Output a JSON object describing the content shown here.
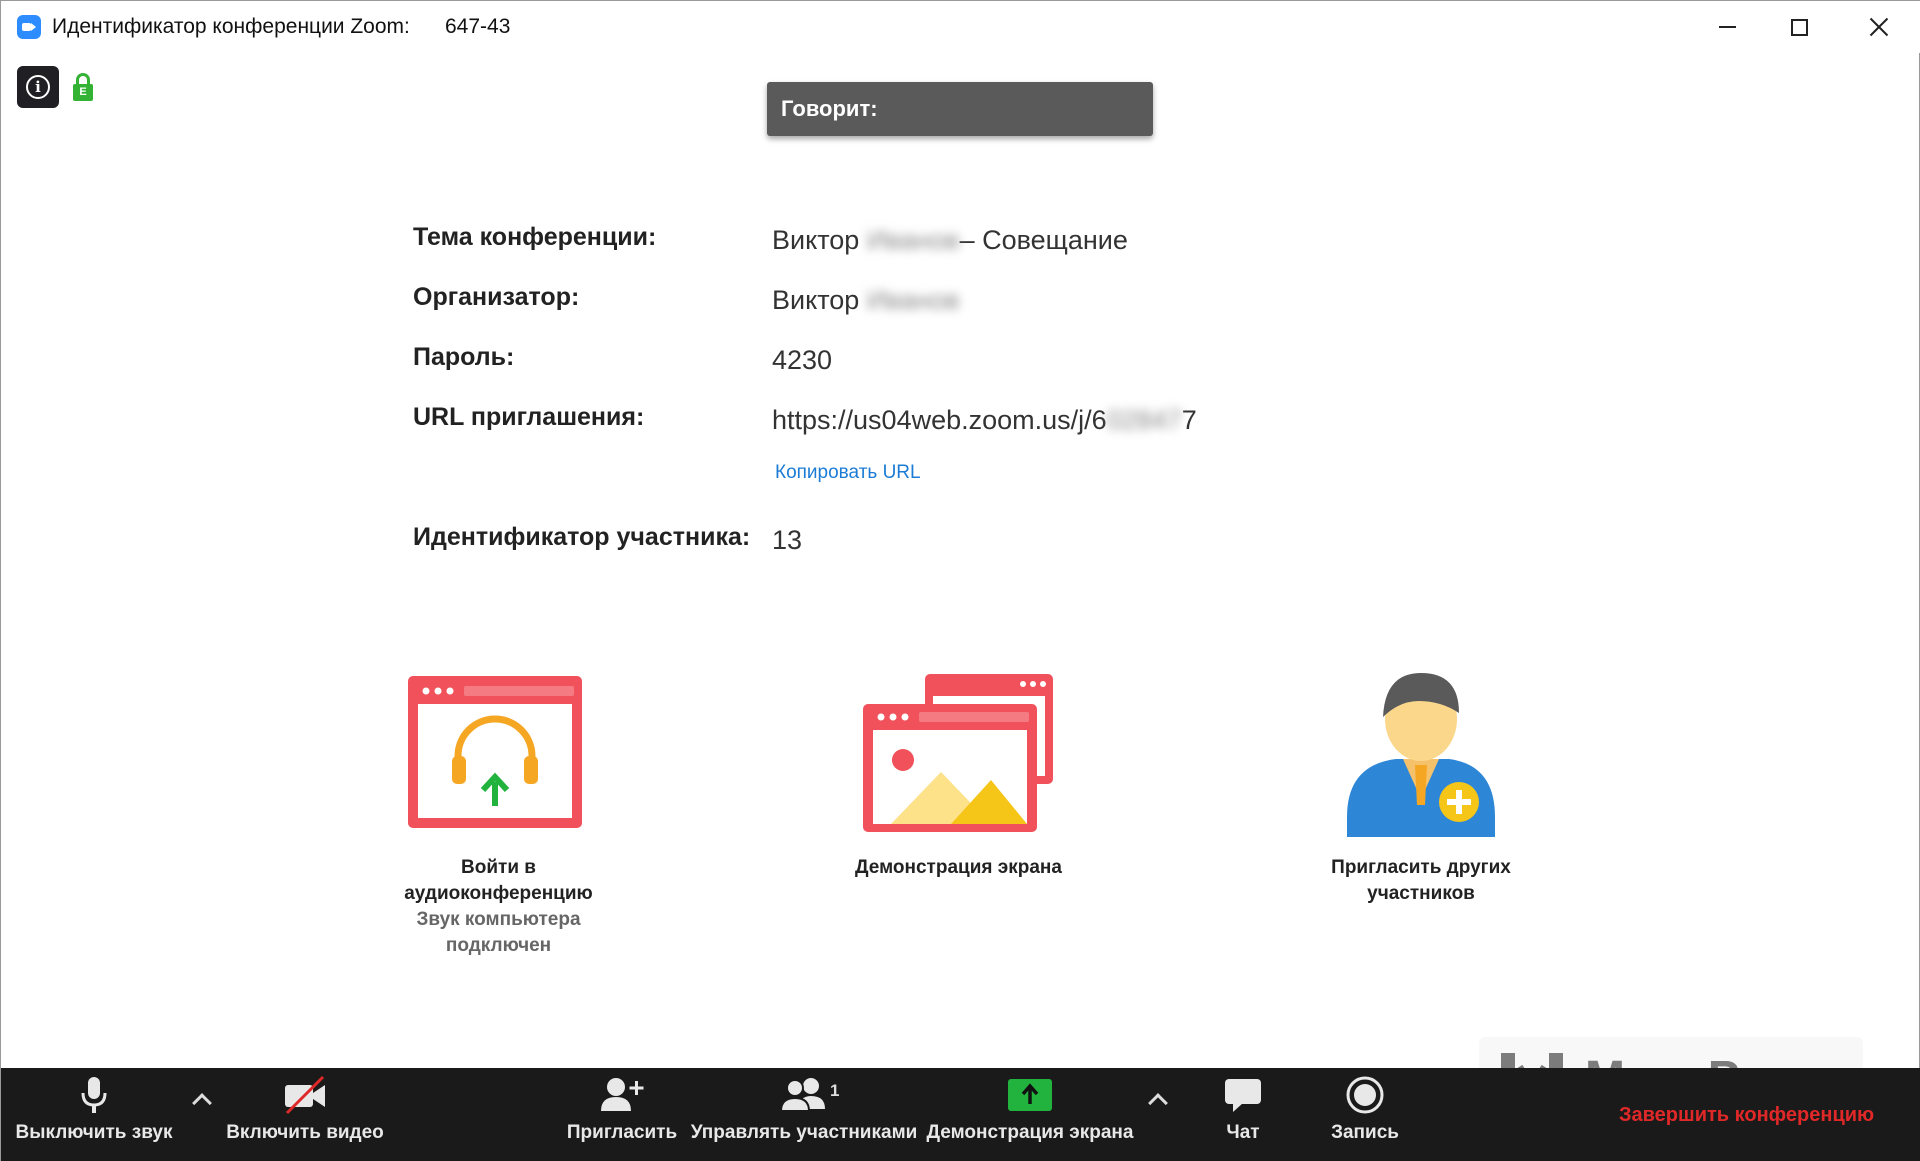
{
  "window": {
    "title": "Идентификатор конференции Zoom:",
    "meeting_id": "647-43"
  },
  "security": {
    "lock_letter": "E"
  },
  "speaking": {
    "label": "Говорит:"
  },
  "meeting_info": {
    "topic_label": "Тема конференции:",
    "topic_first": "Виктор",
    "topic_blurred": "Иванов",
    "topic_rest": "– Совещание",
    "host_label": "Организатор:",
    "host_first": "Виктор",
    "host_blurred": "Иванов",
    "password_label": "Пароль:",
    "password_value": "4230",
    "url_label": "URL приглашения:",
    "url_prefix": "https://us04web.zoom.us/j/6",
    "url_blurred": "02847",
    "url_suffix": "7",
    "copy_url": "Копировать URL",
    "participant_label": "Идентификатор участника:",
    "participant_value": "13"
  },
  "tiles": {
    "audio_line1": "Войти в",
    "audio_line2": "аудиоконференцию",
    "audio_status1": "Звук компьютера",
    "audio_status2": "подключен",
    "share": "Демонстрация экрана",
    "invite_line1": "Пригласить других",
    "invite_line2": "участников"
  },
  "toolbar": {
    "mute": "Выключить звук",
    "video": "Включить видео",
    "invite": "Пригласить",
    "participants": "Управлять участниками",
    "participants_count": "1",
    "share": "Демонстрация экрана",
    "chat": "Чат",
    "record": "Запись",
    "end": "Завершить конференцию"
  },
  "watermark": {
    "text": "MegaProgz"
  },
  "colors": {
    "accent_blue": "#2d8cff",
    "lock_green": "#34b233",
    "link_blue": "#1c7cd5",
    "tile_red": "#f0515b",
    "end_red": "#e02828",
    "toolbar_bg": "#1a1a1a",
    "share_green": "#21b33e"
  }
}
